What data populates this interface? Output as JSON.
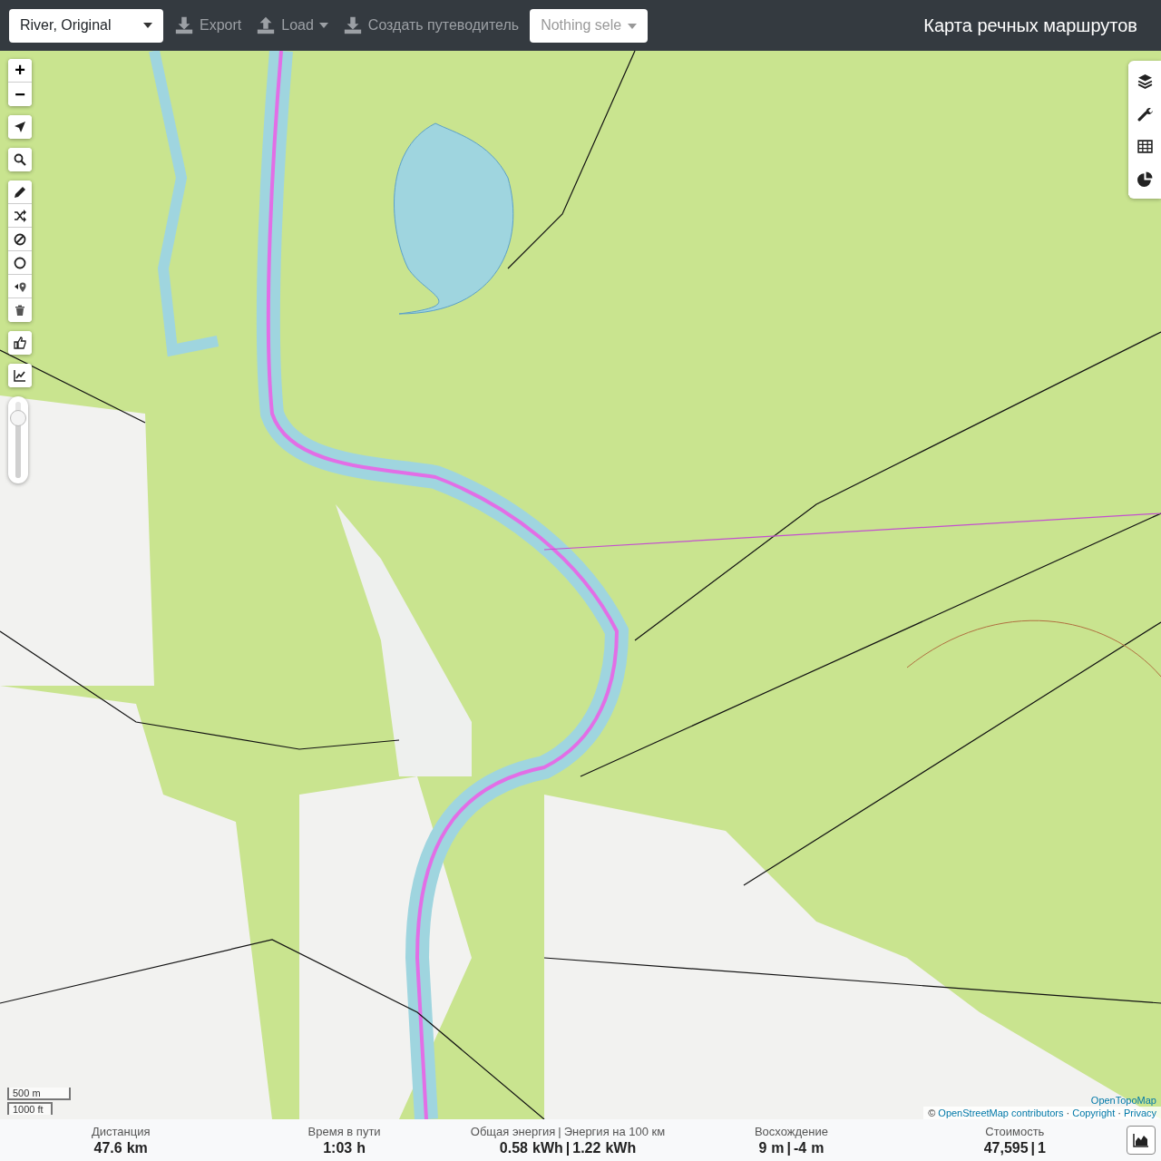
{
  "toolbar": {
    "profile_select": {
      "value": "River, Original"
    },
    "buttons": [
      {
        "label": "Export",
        "kind": "download",
        "dropdown": false
      },
      {
        "label": "Load",
        "kind": "upload",
        "dropdown": true
      },
      {
        "label": "Создать путеводитель",
        "kind": "download",
        "dropdown": false
      }
    ],
    "selection": {
      "placeholder": "Nothing sele"
    },
    "title": "Карта речных маршрутов"
  },
  "map_controls": {
    "zoom_in": "+",
    "zoom_out": "−",
    "opacity_slider": {
      "level": 0.78
    }
  },
  "scale": [
    "500 m",
    "1000 ft"
  ],
  "attribution": {
    "layer": "OpenTopoMap",
    "prefix": "©",
    "links": [
      "OpenStreetMap contributors",
      "Copyright",
      "Privacy"
    ],
    "separator": "·"
  },
  "stats": [
    {
      "labels": [
        "Дистанция"
      ],
      "values": [
        {
          "value": "47.6",
          "unit": "km"
        }
      ]
    },
    {
      "labels": [
        "Время в пути"
      ],
      "values": [
        {
          "value": "1:03",
          "unit": "h"
        }
      ]
    },
    {
      "labels": [
        "Общая энергия",
        "Энергия на 100 км"
      ],
      "label_separator": "|",
      "values": [
        {
          "value": "0.58",
          "unit": "kWh"
        },
        {
          "value": "1.22",
          "unit": "kWh"
        }
      ],
      "value_separator": "|"
    },
    {
      "labels": [
        "Восхождение"
      ],
      "values": [
        {
          "value": "9",
          "unit": "m"
        },
        {
          "value": "-4",
          "unit": "m"
        }
      ],
      "value_separator": "|"
    },
    {
      "labels": [
        "Стоимость"
      ],
      "values": [
        {
          "value": "47,595"
        },
        {
          "value": "1"
        }
      ],
      "value_separator": "|"
    }
  ]
}
